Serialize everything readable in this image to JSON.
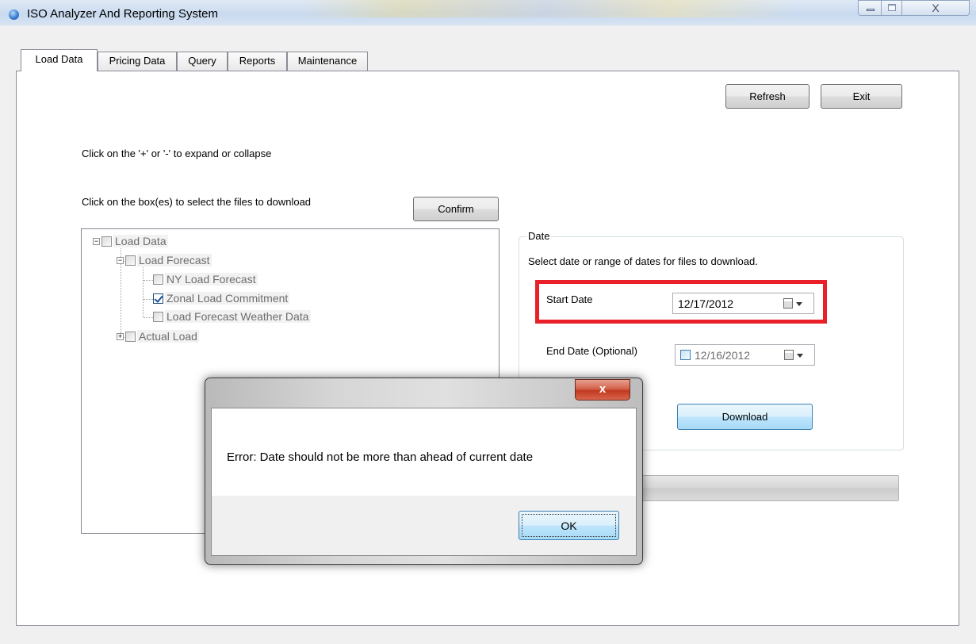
{
  "window": {
    "title": "ISO Analyzer And Reporting System",
    "close_glyph": "X"
  },
  "tabs": [
    {
      "label": "Load Data",
      "active": true
    },
    {
      "label": "Pricing Data",
      "active": false
    },
    {
      "label": "Query",
      "active": false
    },
    {
      "label": "Reports",
      "active": false
    },
    {
      "label": "Maintenance",
      "active": false
    }
  ],
  "toolbar": {
    "refresh_label": "Refresh",
    "exit_label": "Exit"
  },
  "instructions": {
    "expand_hint": "Click on the '+' or '-' to expand or collapse",
    "select_hint": "Click on the box(es) to select the files to download",
    "confirm_label": "Confirm"
  },
  "tree": {
    "root": {
      "label": "Load Data",
      "expander": "−",
      "checked": false
    },
    "load_forecast": {
      "label": "Load Forecast",
      "expander": "−",
      "checked": false
    },
    "ny_load_forecast": {
      "label": "NY Load Forecast",
      "checked": false
    },
    "zonal_load_commitment": {
      "label": "Zonal Load Commitment",
      "checked": true
    },
    "load_forecast_weather": {
      "label": "Load Forecast Weather Data",
      "checked": false
    },
    "actual_load": {
      "label": "Actual Load",
      "expander": "+",
      "checked": false
    }
  },
  "date_group": {
    "legend": "Date",
    "description": "Select date or range of dates for files to download.",
    "start_label": "Start Date",
    "start_value": "12/17/2012",
    "end_label": "End Date (Optional)",
    "end_value": "12/16/2012",
    "download_label": "Download"
  },
  "dialog": {
    "close_glyph": "x",
    "message": "Error: Date should not be more than ahead of current date",
    "ok_label": "OK"
  },
  "colors": {
    "highlight": "#e8202a",
    "dialog_close": "#c2391f"
  }
}
